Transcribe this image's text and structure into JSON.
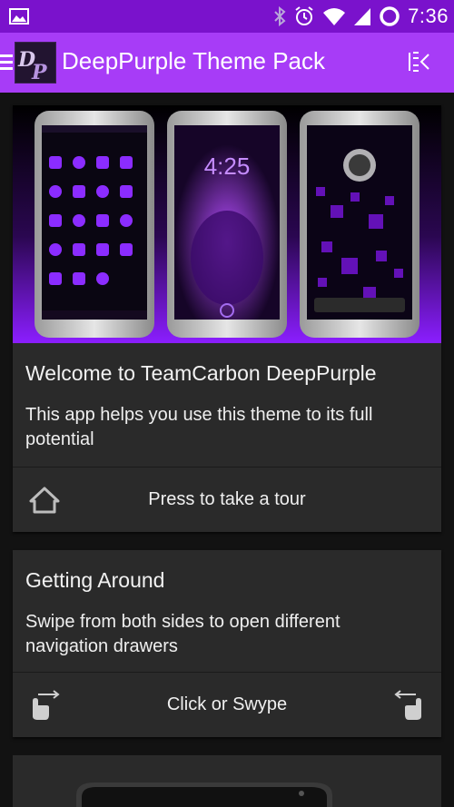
{
  "status_bar": {
    "time": "7:36",
    "icons": [
      "image-icon",
      "bluetooth-icon",
      "alarm-icon",
      "wifi-icon",
      "signal-icon",
      "battery-icon"
    ]
  },
  "app_bar": {
    "title": "DeepPurple Theme Pack",
    "logo_text": "DP"
  },
  "hero_phones": {
    "clock_text": "4:25"
  },
  "welcome_card": {
    "heading": "Welcome to TeamCarbon DeepPurple",
    "body": "This app helps you use this theme to its full potential",
    "action_label": "Press to take a tour",
    "action_icon": "home-icon"
  },
  "getting_around_card": {
    "heading": "Getting Around",
    "body": "Swipe from both sides to open different navigation drawers",
    "action_label": "Click or Swype",
    "left_icon": "swipe-right-icon",
    "right_icon": "swipe-left-icon"
  },
  "colors": {
    "status_bar": "#7a12cc",
    "app_bar": "#a73cf7",
    "card": "#2a2a2a",
    "background": "#121212",
    "accent_purple": "#9b1fff"
  }
}
